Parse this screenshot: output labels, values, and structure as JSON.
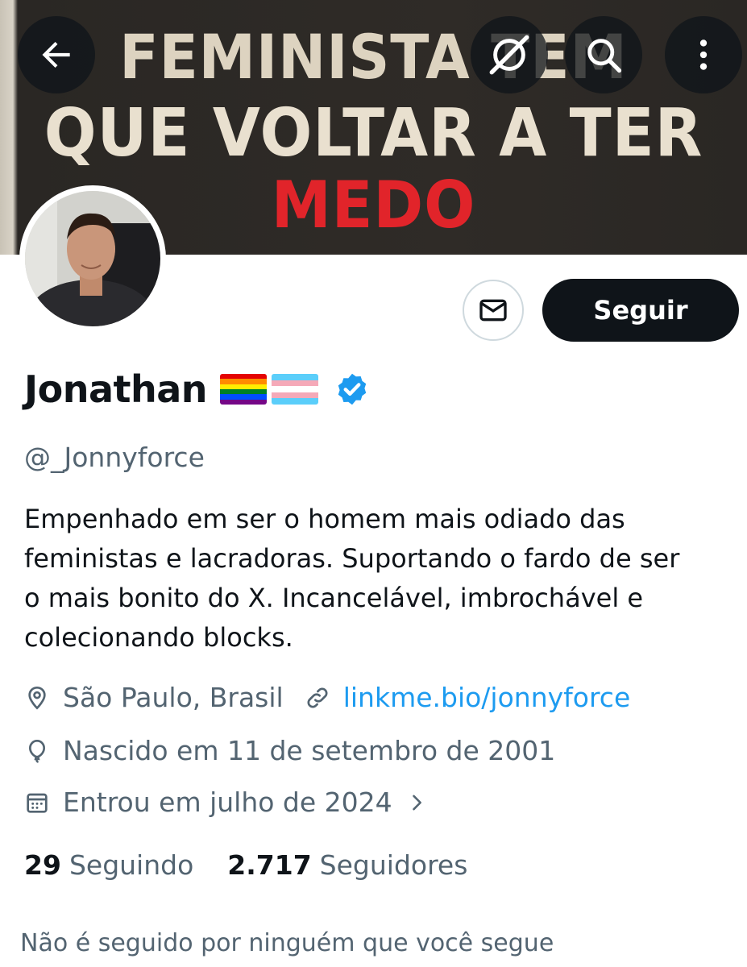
{
  "banner": {
    "line1": "FEMINISTA TEM",
    "line2": "QUE VOLTAR A TER",
    "line3": "MEDO"
  },
  "header": {
    "back_icon": "arrow-left-icon",
    "grok_icon": "grok-icon",
    "search_icon": "search-icon",
    "more_icon": "more-vertical-icon"
  },
  "actions": {
    "message_icon": "mail-icon",
    "follow_label": "Seguir"
  },
  "profile": {
    "name": "Jonathan",
    "flags": [
      "rainbow-flag",
      "transgender-flag"
    ],
    "verified_icon": "verified-badge-icon",
    "handle": "@_Jonnyforce",
    "bio_lines": [
      "Empenhado em ser o homem mais odiado das",
      "feministas e lacradoras. Suportando o fardo de ser",
      "o mais bonito do X. Incancelável, imbrochável e",
      "colecionando blocks."
    ],
    "location": "São Paulo, Brasil",
    "website": "linkme.bio/jonnyforce",
    "birthday": "Nascido em 11 de setembro de 2001",
    "joined": "Entrou em julho de 2024"
  },
  "stats": {
    "following_count": "29",
    "following_label": "Seguindo",
    "followers_count": "2.717",
    "followers_label": "Seguidores"
  },
  "footer": {
    "not_followed": "Não é seguido por ninguém que você segue"
  },
  "colors": {
    "accent": "#1d9bf0",
    "text_primary": "#0f1419",
    "text_secondary": "#536471",
    "banner_red": "#e1242a"
  }
}
